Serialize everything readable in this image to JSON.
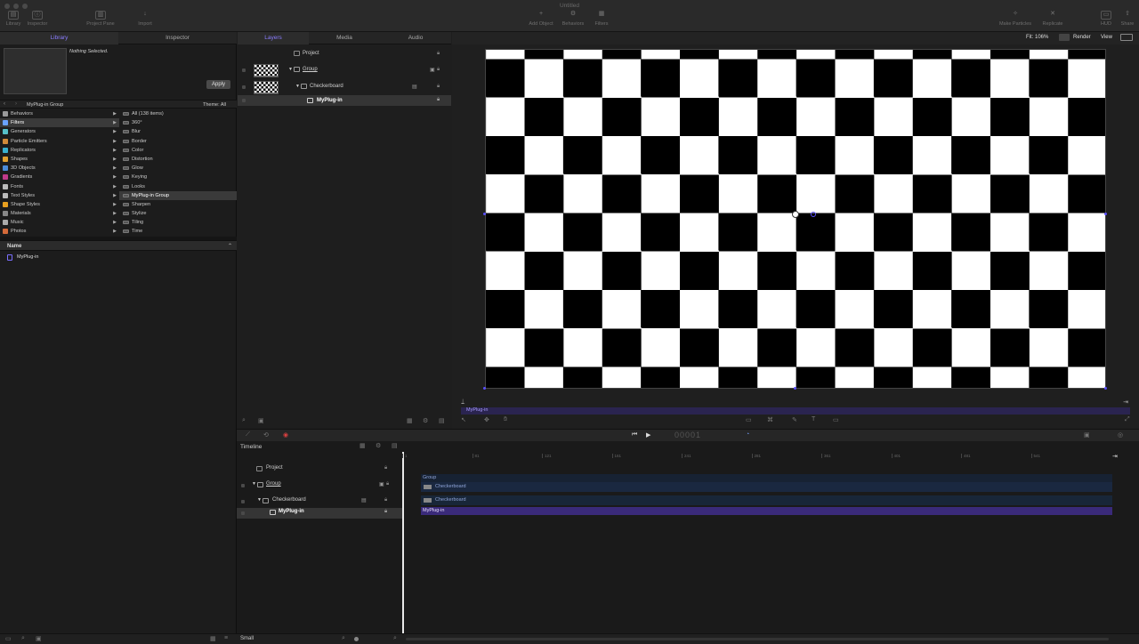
{
  "window": {
    "title": "Untitled"
  },
  "toolbar": {
    "left": [
      {
        "label": "Library"
      },
      {
        "label": "Inspector"
      },
      {
        "label": "Project Pane"
      },
      {
        "label": "Import"
      }
    ],
    "center": [
      {
        "label": "Add Object"
      },
      {
        "label": "Behaviors"
      },
      {
        "label": "Filters"
      }
    ],
    "right": [
      {
        "label": "Make Particles"
      },
      {
        "label": "Replicate"
      },
      {
        "label": "HUD"
      },
      {
        "label": "Share"
      }
    ]
  },
  "left_tabs": {
    "library": "Library",
    "inspector": "Inspector"
  },
  "preview": {
    "status": "Nothing Selected.",
    "apply_label": "Apply"
  },
  "pathbar": {
    "location": "MyPlug-in Group",
    "theme": "Theme: All"
  },
  "categories": [
    {
      "label": "Behaviors",
      "color": "#9a9a9a"
    },
    {
      "label": "Filters",
      "color": "#6aa3ff",
      "selected": true
    },
    {
      "label": "Generators",
      "color": "#56c0c9"
    },
    {
      "label": "Particle Emitters",
      "color": "#d08a3a"
    },
    {
      "label": "Replicators",
      "color": "#39b0d0"
    },
    {
      "label": "Shapes",
      "color": "#e0a030"
    },
    {
      "label": "3D Objects",
      "color": "#4a8ad8"
    },
    {
      "label": "Gradients",
      "color": "#c03a8a"
    },
    {
      "label": "Fonts",
      "color": "#bbbbbb"
    },
    {
      "label": "Text Styles",
      "color": "#bbbbbb"
    },
    {
      "label": "Shape Styles",
      "color": "#e8a020"
    },
    {
      "label": "Materials",
      "color": "#888888"
    },
    {
      "label": "Music",
      "color": "#aaaaaa"
    },
    {
      "label": "Photos",
      "color": "#d46a3a"
    }
  ],
  "filters": [
    {
      "label": "All (138 items)"
    },
    {
      "label": "360°"
    },
    {
      "label": "Blur"
    },
    {
      "label": "Border"
    },
    {
      "label": "Color"
    },
    {
      "label": "Distortion"
    },
    {
      "label": "Glow"
    },
    {
      "label": "Keying"
    },
    {
      "label": "Looks"
    },
    {
      "label": "MyPlug-in Group",
      "selected": true
    },
    {
      "label": "Sharpen"
    },
    {
      "label": "Stylize"
    },
    {
      "label": "Tiling"
    },
    {
      "label": "Time"
    }
  ],
  "name_list": {
    "header": "Name",
    "items": [
      {
        "label": "MyPlug-in"
      }
    ]
  },
  "project_tabs": {
    "layers": "Layers",
    "media": "Media",
    "audio": "Audio"
  },
  "layers": {
    "project": "Project",
    "group": "Group",
    "checkerboard": "Checkerboard",
    "plugin": "MyPlug-in"
  },
  "canvas_bar": {
    "fit": "Fit: 106%",
    "render": "Render",
    "view": "View"
  },
  "canvas": {
    "selected_layer": "MyPlug-in",
    "accent": "#5a4fff"
  },
  "transport": {
    "timecode": "00001"
  },
  "timeline": {
    "label": "Timeline",
    "project": "Project",
    "group": "Group",
    "checkerboard": "Checkerboard",
    "plugin": "MyPlug-in",
    "ruler": [
      "1",
      "81",
      "121",
      "161",
      "241",
      "281",
      "361",
      "401",
      "481",
      "541"
    ],
    "tracks": {
      "group": "Group",
      "checker1": "Checkerboard",
      "checker2": "Checkerboard",
      "plugin": "MyPlug-in"
    }
  },
  "bottom": {
    "size": "Small"
  }
}
